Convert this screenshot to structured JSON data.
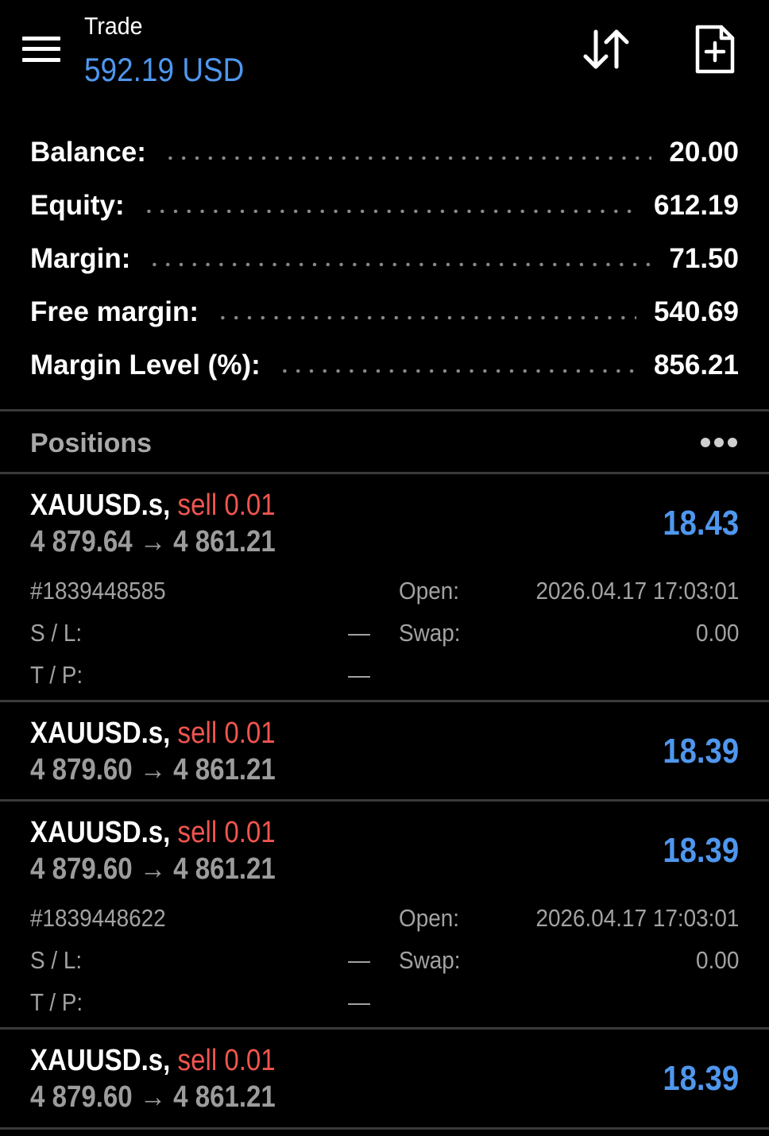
{
  "header": {
    "title": "Trade",
    "subtitle": "592.19 USD",
    "menu_icon": "hamburger-menu-icon",
    "sort_icon": "sort-arrows-icon",
    "new_order_icon": "new-order-document-plus-icon"
  },
  "summary": {
    "balance_label": "Balance:",
    "balance_value": "20.00",
    "equity_label": "Equity:",
    "equity_value": "612.19",
    "margin_label": "Margin:",
    "margin_value": "71.50",
    "free_margin_label": "Free margin:",
    "free_margin_value": "540.69",
    "margin_level_label": "Margin Level (%):",
    "margin_level_value": "856.21"
  },
  "positions_header": {
    "title": "Positions",
    "more_icon": "more-dots-icon"
  },
  "positions": [
    {
      "symbol": "XAUUSD.s,",
      "side": "sell 0.01",
      "open_price": "4 879.64",
      "arrow": "→",
      "current_price": "4 861.21",
      "profit": "18.43",
      "ticket": "#1839448585",
      "open_label": "Open:",
      "open_time": "2026.04.17 17:03:01",
      "sl_label": "S / L:",
      "sl_value": "—",
      "swap_label": "Swap:",
      "swap_value": "0.00",
      "tp_label": "T / P:",
      "tp_value": "—"
    },
    {
      "symbol": "XAUUSD.s,",
      "side": "sell 0.01",
      "open_price": "4 879.60",
      "arrow": "→",
      "current_price": "4 861.21",
      "profit": "18.39"
    },
    {
      "symbol": "XAUUSD.s,",
      "side": "sell 0.01",
      "open_price": "4 879.60",
      "arrow": "→",
      "current_price": "4 861.21",
      "profit": "18.39",
      "ticket": "#1839448622",
      "open_label": "Open:",
      "open_time": "2026.04.17 17:03:01",
      "sl_label": "S / L:",
      "sl_value": "—",
      "swap_label": "Swap:",
      "swap_value": "0.00",
      "tp_label": "T / P:",
      "tp_value": "—"
    },
    {
      "symbol": "XAUUSD.s,",
      "side": "sell 0.01",
      "open_price": "4 879.60",
      "arrow": "→",
      "current_price": "4 861.21",
      "profit": "18.39"
    }
  ],
  "colors": {
    "background": "#000000",
    "accent_blue": "#4f97ee",
    "sell_red": "#f0554e",
    "muted_gray": "#9c9c9c",
    "divider": "#3a3a3a"
  }
}
